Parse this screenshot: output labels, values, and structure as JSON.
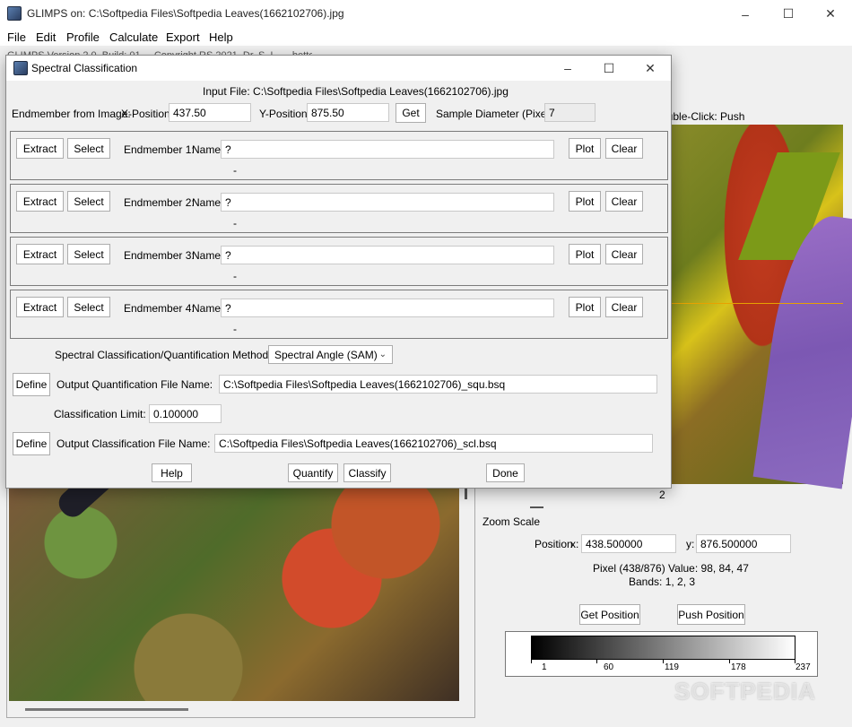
{
  "main_window": {
    "title": "GLIMPS on: C:\\Softpedia Files\\Softpedia Leaves(1662102706).jpg",
    "menu": [
      "File",
      "Edit",
      "Profile",
      "Calculate",
      "Export",
      "Help"
    ],
    "behind_text": "GLIMPS Version 2.0, Build: 01 ... Copyright RS 2021, Dr. S. L. ... better",
    "double_click_label": "ouble-Click: Push",
    "zoom_value": "2",
    "zoom_scale_label": "Zoom Scale",
    "position_label": "Position",
    "x_label": "x:",
    "x_value": "438.500000",
    "y_label": "y:",
    "y_value": "876.500000",
    "pixel_value_text": "Pixel (438/876) Value: 98, 84, 47",
    "bands_text": "Bands:  1,  2,  3",
    "get_position_label": "Get Position",
    "push_position_label": "Push Position",
    "colorbar_ticks": [
      "1",
      "60",
      "119",
      "178",
      "237"
    ],
    "watermark": "SOFTPEDIA"
  },
  "dialog": {
    "title": "Spectral Classification",
    "input_file": "Input File: C:\\Softpedia Files\\Softpedia Leaves(1662102706).jpg",
    "endmember_from_image_label": "Endmember from Image:",
    "x_position_label": "X-Position:",
    "x_position_value": "437.50",
    "y_position_label": "Y-Position:",
    "y_position_value": "875.50",
    "get_label": "Get",
    "sample_diameter_label": "Sample Diameter (Pixels):",
    "sample_diameter_value": "7",
    "endmembers": [
      {
        "label": "Endmember 1:",
        "name_label": "Name",
        "name_value": "?",
        "sub": "-"
      },
      {
        "label": "Endmember 2:",
        "name_label": "Name",
        "name_value": "?",
        "sub": "-"
      },
      {
        "label": "Endmember 3:",
        "name_label": "Name",
        "name_value": "?",
        "sub": "-"
      },
      {
        "label": "Endmember 4:",
        "name_label": "Name",
        "name_value": "?",
        "sub": "-"
      }
    ],
    "extract_label": "Extract",
    "select_label": "Select",
    "plot_label": "Plot",
    "clear_label": "Clear",
    "method_label": "Spectral Classification/Quantification Method:",
    "method_value": "Spectral Angle (SAM)",
    "define_label": "Define",
    "quant_file_label": "Output Quantification File Name:",
    "quant_file_value": "C:\\Softpedia Files\\Softpedia Leaves(1662102706)_squ.bsq",
    "class_limit_label": "Classification Limit:",
    "class_limit_value": "0.100000",
    "class_file_label": "Output Classification File Name:",
    "class_file_value": "C:\\Softpedia Files\\Softpedia Leaves(1662102706)_scl.bsq",
    "help_label": "Help",
    "quantify_label": "Quantify",
    "classify_label": "Classify",
    "done_label": "Done"
  },
  "colors": {
    "titlebar": "#ffffff",
    "dialog_bg": "#f0f0f0",
    "zoom_line": "#e8a100"
  },
  "icons": [
    "app-icon",
    "minimize-icon",
    "maximize-icon",
    "close-icon",
    "chevron-down-icon"
  ]
}
